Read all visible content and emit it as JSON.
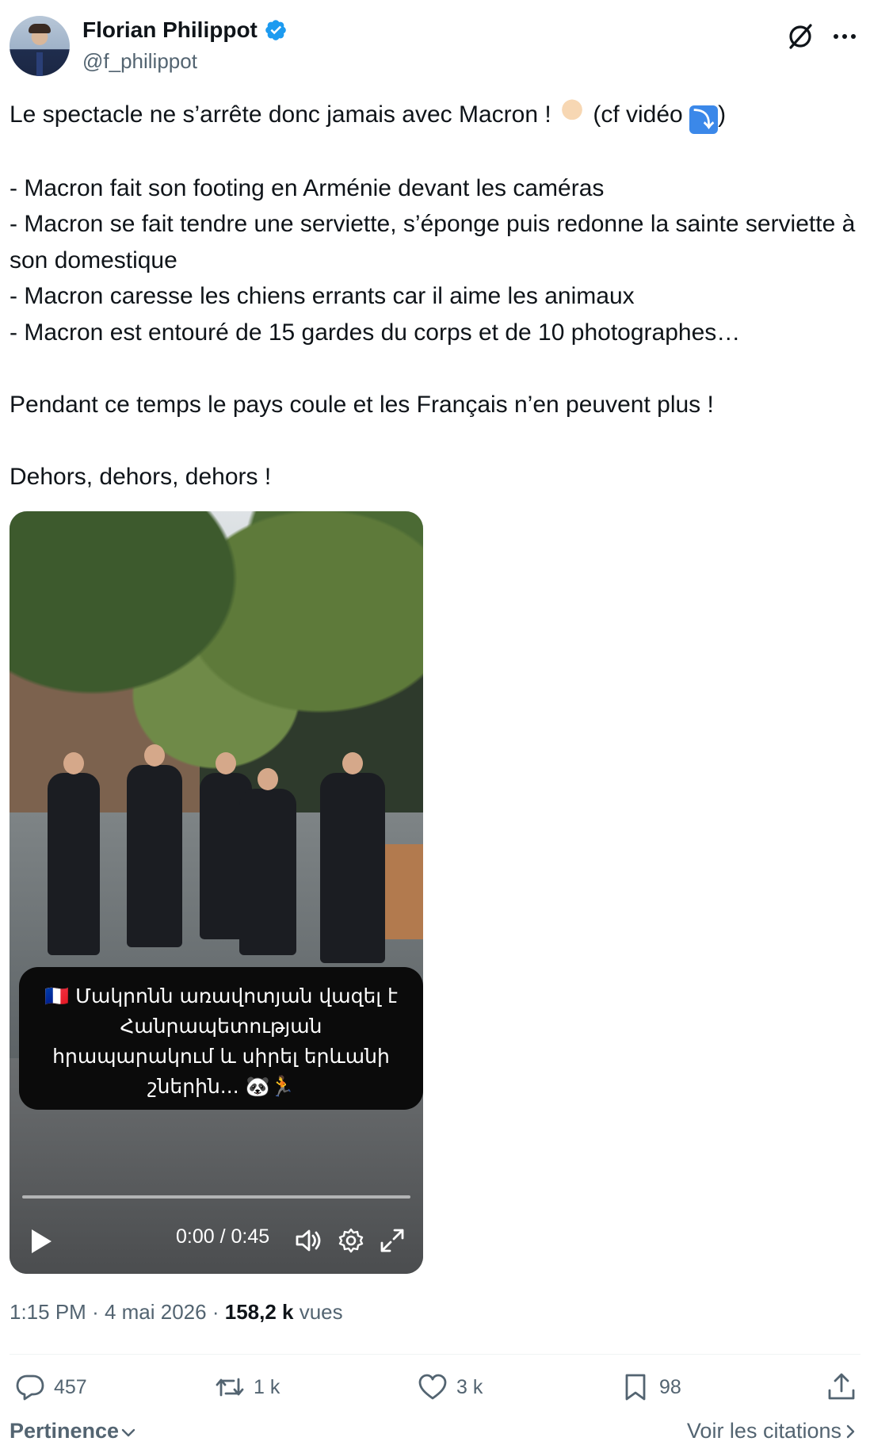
{
  "author": {
    "display_name": "Florian Philippot",
    "handle": "@f_philippot",
    "verified": true
  },
  "tweet": {
    "text_line1": "Le spectacle ne s’arrête donc jamais avec Macron ! ",
    "text_line1_b": " (cf vidéo ",
    "text_line1_c": ")",
    "bullets": [
      "- Macron fait son footing en Arménie devant les caméras",
      "- Macron se fait tendre une serviette, s’éponge puis redonne la sainte serviette à son domestique",
      "- Macron caresse les chiens errants car il aime les animaux",
      "- Macron est entouré de 15 gardes du corps et de 10 photographes…"
    ],
    "paragraph2": "Pendant ce temps le pays coule et les Français n’en peuvent plus !",
    "paragraph3": "Dehors, dehors, dehors !"
  },
  "video": {
    "caption": "🇫🇷 Մակրոնն առավոտյան վազել է Հանրապետության հրապարակում և սիրել երևանի շներին... 🐼🏃",
    "time": "0:00 / 0:45",
    "progress": 0.0
  },
  "meta": {
    "time": "1:15 PM",
    "date": "4 mai 2026",
    "views": "158,2 k",
    "views_label": "vues"
  },
  "actions": {
    "replies": "457",
    "reposts": "1 k",
    "likes": "3 k",
    "bookmarks": "98"
  },
  "footer": {
    "sort_label": "Pertinence",
    "quotes_label": "Voir les citations"
  },
  "colors": {
    "text": "#0f1419",
    "secondary": "#536471",
    "verified": "#1d9bf0",
    "divider": "#eff3f4"
  }
}
